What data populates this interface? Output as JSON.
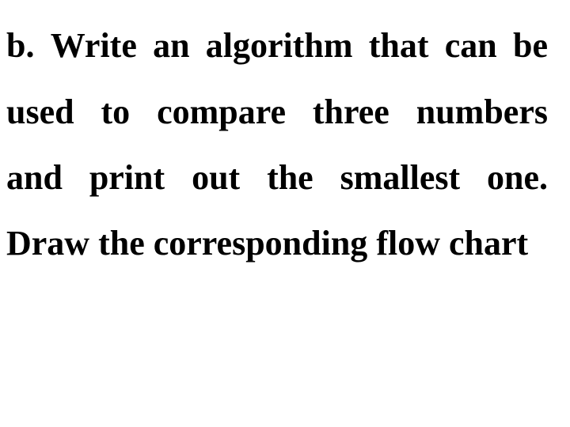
{
  "question": {
    "label": "b.",
    "lines": [
      [
        "b.",
        "Write",
        "an",
        "algorithm",
        "that",
        "can",
        "be"
      ],
      [
        "used",
        "to",
        "compare",
        "three",
        "numbers"
      ],
      [
        "and",
        "print",
        "out",
        "the",
        "smallest",
        "one."
      ],
      [
        "Draw",
        "the",
        "corresponding",
        "flow",
        "chart"
      ]
    ],
    "full_text": "b. Write an algorithm that can be used to compare three numbers and print out the smallest one. Draw the corresponding flow chart"
  }
}
